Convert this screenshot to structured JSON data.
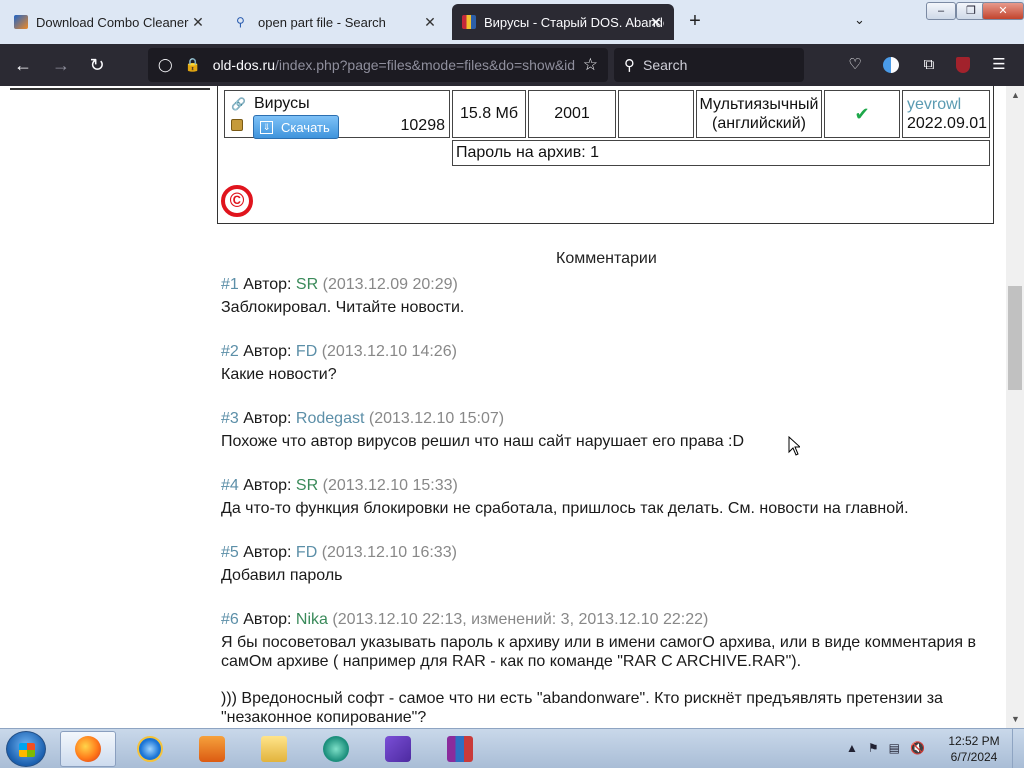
{
  "browser": {
    "tabs": [
      {
        "title": "Download Combo Cleaner",
        "active": false
      },
      {
        "title": "open part file - Search",
        "active": false
      },
      {
        "title": "Вирусы - Старый DOS. Abandonware",
        "active": true
      }
    ],
    "new_tab_label": "+",
    "tab_list_label": "⌄",
    "window_controls": {
      "minimize": "–",
      "maximize": "❐",
      "close": "✕"
    },
    "url_host": "old-dos.ru",
    "url_path": "/index.php?page=files&mode=files&do=show&id",
    "search_placeholder": "Search",
    "extension_badge": "1"
  },
  "file": {
    "name": "Вирусы",
    "download_label": "Скачать",
    "downloads": "10298",
    "size": "15.8 Мб",
    "year": "2001",
    "language_line1": "Мультиязычный",
    "language_line2": "(английский)",
    "uploader": "yevrowl",
    "upload_date": "2022.09.01",
    "password_note": "Пароль на архив: 1",
    "copyright_symbol": "©"
  },
  "comments_title": "Комментарии",
  "author_label": "Автор:",
  "comments": [
    {
      "num": "#1",
      "author": "SR",
      "date": "(2013.12.09 20:29)",
      "body": "Заблокировал. Читайте новости."
    },
    {
      "num": "#2",
      "author": "FD",
      "date": "(2013.12.10 14:26)",
      "body": "Какие новости?"
    },
    {
      "num": "#3",
      "author": "Rodegast",
      "date": "(2013.12.10 15:07)",
      "body": "Похоже что автор вирусов решил что наш сайт нарушает его права :D"
    },
    {
      "num": "#4",
      "author": "SR",
      "date": "(2013.12.10 15:33)",
      "body": "Да что-то функция блокировки не сработала, пришлось так делать. См. новости на главной."
    },
    {
      "num": "#5",
      "author": "FD",
      "date": "(2013.12.10 16:33)",
      "body": "Добавил пароль"
    },
    {
      "num": "#6",
      "author": "Nika",
      "date": "(2013.12.10 22:13, изменений: 3, 2013.12.10 22:22)",
      "body": "Я бы посоветовал указывать пароль к архиву или в имени самогО архива, или в виде комментария в самОм архиве ( например для RAR - как по команде \"RAR C ARCHIVE.RAR\").",
      "body2": ")))  Вредоносный софт - самое что ни есть \"abandonware\". Кто рискнёт предъявлять претензии за \"незаконное копирование\"?"
    }
  ],
  "taskbar": {
    "clock_time": "12:52 PM",
    "clock_date": "6/7/2024"
  },
  "colors": {
    "tab_strip": "#dde7f4",
    "toolbar": "#2b2a33",
    "link": "#5c8fa8",
    "copyright_red": "#e0141d",
    "check_green": "#1ea84a"
  }
}
